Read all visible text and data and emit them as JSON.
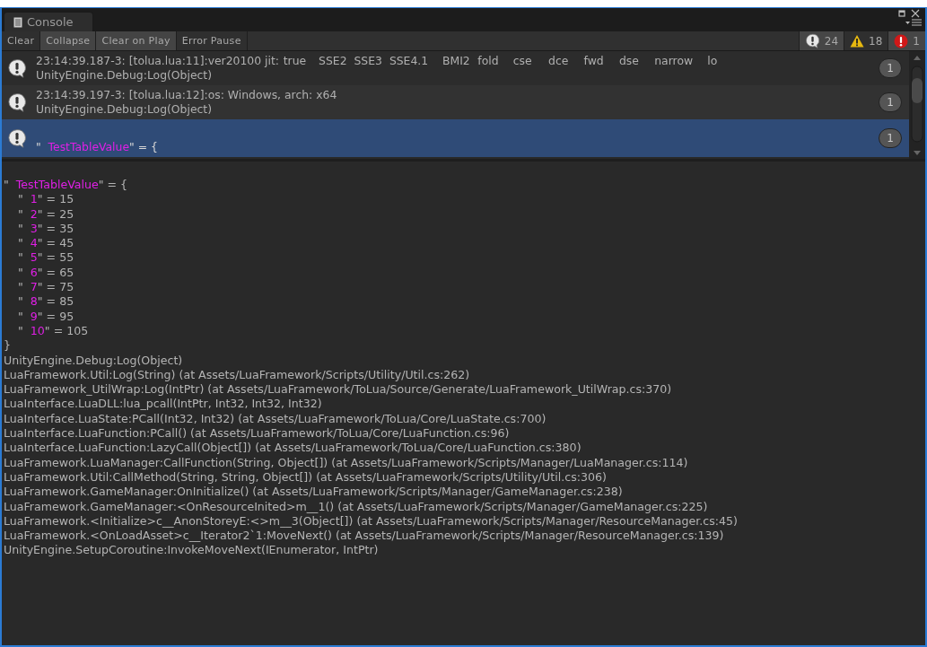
{
  "window": {
    "title": "Console"
  },
  "toolbar": {
    "buttons": [
      {
        "label": "Clear",
        "on": false
      },
      {
        "label": "Collapse",
        "on": true
      },
      {
        "label": "Clear on Play",
        "on": true
      },
      {
        "label": "Error Pause",
        "on": false
      }
    ],
    "counters": [
      {
        "kind": "info",
        "count": "24",
        "on": true
      },
      {
        "kind": "warning",
        "count": "18",
        "on": false
      },
      {
        "kind": "error",
        "count": "1",
        "on": true
      }
    ]
  },
  "log": [
    {
      "kind": "info",
      "selected": false,
      "count": "1",
      "lines": [
        [
          {
            "kind": "plain",
            "text": "23:14:39.187-3: [tolua.lua:11]:ver20100 jit:\ttrue\tSSE2\tSSE3\tSSE4.1\tBMI2\tfold\tcse\tdce\tfwd\tdse\tnarrow\tlo"
          }
        ],
        [
          {
            "kind": "plain",
            "text": "UnityEngine.Debug:Log(Object)"
          }
        ]
      ]
    },
    {
      "kind": "info",
      "selected": false,
      "count": "1",
      "lines": [
        [
          {
            "kind": "plain",
            "text": "23:14:39.197-3: [tolua.lua:12]:os: Windows, arch: x64"
          }
        ],
        [
          {
            "kind": "plain",
            "text": "UnityEngine.Debug:Log(Object)"
          }
        ]
      ]
    },
    {
      "kind": "info",
      "selected": true,
      "count": "1",
      "lines": [
        [
          {
            "kind": "plain",
            "text": "\"  "
          },
          {
            "kind": "key",
            "text": "TestTableValue"
          },
          {
            "kind": "plain",
            "text": "\" = {"
          }
        ]
      ]
    }
  ],
  "detail": {
    "lines": [
      [
        {
          "kind": "plain",
          "text": "\"  "
        },
        {
          "kind": "key",
          "text": "TestTableValue"
        },
        {
          "kind": "plain",
          "text": "\" = {"
        }
      ],
      [
        {
          "kind": "plain",
          "text": "    \"  "
        },
        {
          "kind": "key",
          "text": "1"
        },
        {
          "kind": "plain",
          "text": "\" = 15"
        }
      ],
      [
        {
          "kind": "plain",
          "text": "    \"  "
        },
        {
          "kind": "key",
          "text": "2"
        },
        {
          "kind": "plain",
          "text": "\" = 25"
        }
      ],
      [
        {
          "kind": "plain",
          "text": "    \"  "
        },
        {
          "kind": "key",
          "text": "3"
        },
        {
          "kind": "plain",
          "text": "\" = 35"
        }
      ],
      [
        {
          "kind": "plain",
          "text": "    \"  "
        },
        {
          "kind": "key",
          "text": "4"
        },
        {
          "kind": "plain",
          "text": "\" = 45"
        }
      ],
      [
        {
          "kind": "plain",
          "text": "    \"  "
        },
        {
          "kind": "key",
          "text": "5"
        },
        {
          "kind": "plain",
          "text": "\" = 55"
        }
      ],
      [
        {
          "kind": "plain",
          "text": "    \"  "
        },
        {
          "kind": "key",
          "text": "6"
        },
        {
          "kind": "plain",
          "text": "\" = 65"
        }
      ],
      [
        {
          "kind": "plain",
          "text": "    \"  "
        },
        {
          "kind": "key",
          "text": "7"
        },
        {
          "kind": "plain",
          "text": "\" = 75"
        }
      ],
      [
        {
          "kind": "plain",
          "text": "    \"  "
        },
        {
          "kind": "key",
          "text": "8"
        },
        {
          "kind": "plain",
          "text": "\" = 85"
        }
      ],
      [
        {
          "kind": "plain",
          "text": "    \"  "
        },
        {
          "kind": "key",
          "text": "9"
        },
        {
          "kind": "plain",
          "text": "\" = 95"
        }
      ],
      [
        {
          "kind": "plain",
          "text": "    \"  "
        },
        {
          "kind": "key",
          "text": "10"
        },
        {
          "kind": "plain",
          "text": "\" = 105"
        }
      ],
      [
        {
          "kind": "plain",
          "text": "}"
        }
      ],
      [
        {
          "kind": "plain",
          "text": "UnityEngine.Debug:Log(Object)"
        }
      ],
      [
        {
          "kind": "plain",
          "text": "LuaFramework.Util:Log(String) (at Assets/LuaFramework/Scripts/Utility/Util.cs:262)"
        }
      ],
      [
        {
          "kind": "plain",
          "text": "LuaFramework_UtilWrap:Log(IntPtr) (at Assets/LuaFramework/ToLua/Source/Generate/LuaFramework_UtilWrap.cs:370)"
        }
      ],
      [
        {
          "kind": "plain",
          "text": "LuaInterface.LuaDLL:lua_pcall(IntPtr, Int32, Int32, Int32)"
        }
      ],
      [
        {
          "kind": "plain",
          "text": "LuaInterface.LuaState:PCall(Int32, Int32) (at Assets/LuaFramework/ToLua/Core/LuaState.cs:700)"
        }
      ],
      [
        {
          "kind": "plain",
          "text": "LuaInterface.LuaFunction:PCall() (at Assets/LuaFramework/ToLua/Core/LuaFunction.cs:96)"
        }
      ],
      [
        {
          "kind": "plain",
          "text": "LuaInterface.LuaFunction:LazyCall(Object[]) (at Assets/LuaFramework/ToLua/Core/LuaFunction.cs:380)"
        }
      ],
      [
        {
          "kind": "plain",
          "text": "LuaFramework.LuaManager:CallFunction(String, Object[]) (at Assets/LuaFramework/Scripts/Manager/LuaManager.cs:114)"
        }
      ],
      [
        {
          "kind": "plain",
          "text": "LuaFramework.Util:CallMethod(String, String, Object[]) (at Assets/LuaFramework/Scripts/Utility/Util.cs:306)"
        }
      ],
      [
        {
          "kind": "plain",
          "text": "LuaFramework.GameManager:OnInitialize() (at Assets/LuaFramework/Scripts/Manager/GameManager.cs:238)"
        }
      ],
      [
        {
          "kind": "plain",
          "text": "LuaFramework.GameManager:<OnResourceInited>m__1() (at Assets/LuaFramework/Scripts/Manager/GameManager.cs:225)"
        }
      ],
      [
        {
          "kind": "plain",
          "text": "LuaFramework.<Initialize>c__AnonStoreyE:<>m__3(Object[]) (at Assets/LuaFramework/Scripts/Manager/ResourceManager.cs:45)"
        }
      ],
      [
        {
          "kind": "plain",
          "text": "LuaFramework.<OnLoadAsset>c__Iterator2`1:MoveNext() (at Assets/LuaFramework/Scripts/Manager/ResourceManager.cs:139)"
        }
      ],
      [
        {
          "kind": "plain",
          "text": "UnityEngine.SetupCoroutine:InvokeMoveNext(IEnumerator, IntPtr)"
        }
      ]
    ]
  }
}
